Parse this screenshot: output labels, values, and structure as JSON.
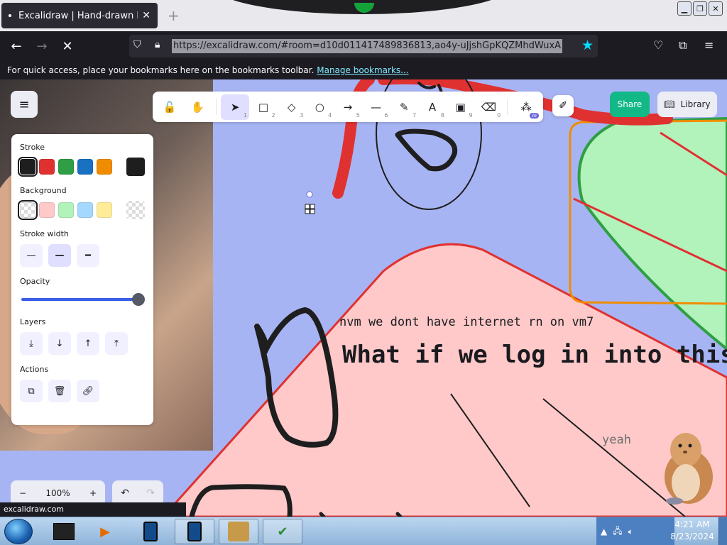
{
  "browser": {
    "tab_title": "Excalidraw | Hand-drawn look & feel",
    "tab_close": "✕",
    "new_tab": "+",
    "url": "https://excalidraw.com/#room=d10d011417489836813,ao4y-uJjshGpKQZMhdWuxA",
    "bookmarks_message": "For quick access, place your bookmarks here on the bookmarks toolbar.",
    "bookmarks_link": "Manage bookmarks...",
    "status_url": "excalidraw.com",
    "icons": [
      "back-icon",
      "forward-icon",
      "stop-icon",
      "shield-icon",
      "lock-icon",
      "star-icon",
      "pocket-icon",
      "extensions-icon",
      "menu-icon"
    ]
  },
  "excalidraw": {
    "toolbar": {
      "tools": [
        {
          "name": "lock",
          "glyph": "🔓",
          "num": ""
        },
        {
          "name": "hand",
          "glyph": "✋",
          "num": ""
        },
        {
          "name": "selection",
          "glyph": "➤",
          "num": "1"
        },
        {
          "name": "rectangle",
          "glyph": "□",
          "num": "2"
        },
        {
          "name": "diamond",
          "glyph": "◇",
          "num": "3"
        },
        {
          "name": "ellipse",
          "glyph": "○",
          "num": "4"
        },
        {
          "name": "arrow",
          "glyph": "→",
          "num": "5"
        },
        {
          "name": "line",
          "glyph": "—",
          "num": "6"
        },
        {
          "name": "draw",
          "glyph": "✎",
          "num": "7"
        },
        {
          "name": "text",
          "glyph": "A",
          "num": "8"
        },
        {
          "name": "image",
          "glyph": "▣",
          "num": "9"
        },
        {
          "name": "eraser",
          "glyph": "⌫",
          "num": "0"
        },
        {
          "name": "more-tools",
          "glyph": "⁂",
          "num": ""
        }
      ],
      "ai_badge": "AI",
      "active_tool": "selection"
    },
    "share_label": "Share",
    "library_label": "Library",
    "properties": {
      "stroke_label": "Stroke",
      "stroke_colors": [
        "#1e1e1e",
        "#e03131",
        "#2f9e44",
        "#1971c2",
        "#f08c00"
      ],
      "stroke_current": "#1e1e1e",
      "background_label": "Background",
      "background_colors": [
        "transparent",
        "#ffc9c9",
        "#b2f2bb",
        "#a5d8ff",
        "#ffec99"
      ],
      "stroke_width_label": "Stroke width",
      "opacity_label": "Opacity",
      "opacity_value": 100,
      "layers_label": "Layers",
      "actions_label": "Actions"
    },
    "zoom": {
      "minus": "−",
      "value": "100%",
      "plus": "+"
    },
    "undo": "↶",
    "redo": "↷"
  },
  "canvas_text": {
    "line1": "nvm we dont have internet rn on vm7",
    "line2": "What if we log in into this in",
    "line3": "yeah"
  },
  "taskbar": {
    "time": "4:21 AM",
    "date": "8/23/2024",
    "items": [
      "terminal-app",
      "media-player-app",
      "tablet-app",
      "tablet-app-active",
      "box-app",
      "app-checkmark"
    ],
    "tray_arrow": "▲"
  }
}
